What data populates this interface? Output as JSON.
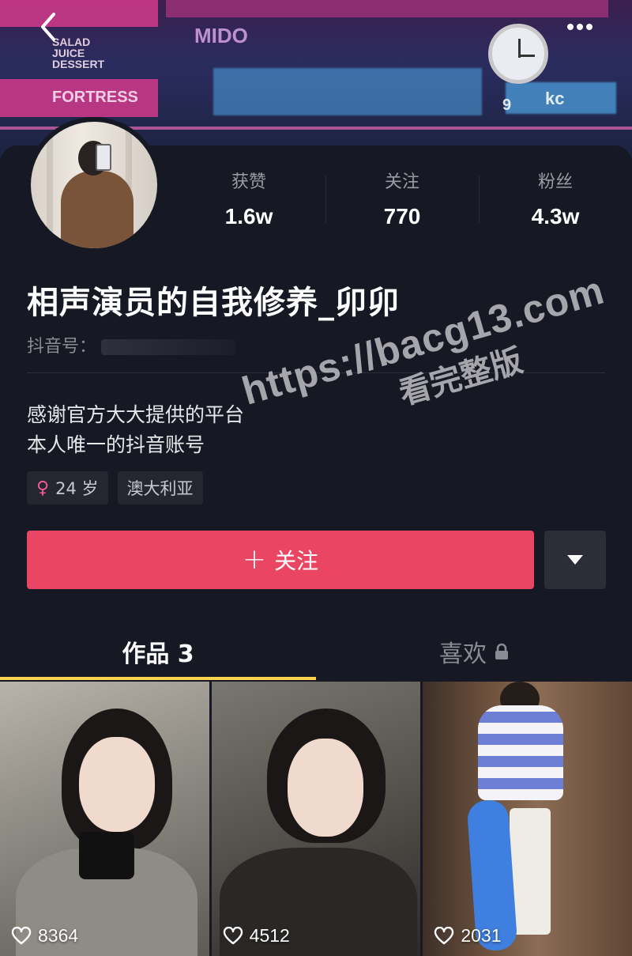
{
  "cover": {
    "signs": [
      "SALAD",
      "JUICE",
      "DESSERT",
      "FORTRESS",
      "MIDO",
      "9",
      "kc"
    ]
  },
  "nav": {
    "back_icon": "chevron-left-icon",
    "more_icon": "more-dots-icon"
  },
  "profile": {
    "stats": [
      {
        "label": "获赞",
        "value": "1.6w"
      },
      {
        "label": "关注",
        "value": "770"
      },
      {
        "label": "粉丝",
        "value": "4.3w"
      }
    ],
    "nickname": "相声演员的自我修养_卯卯",
    "id_label": "抖音号：",
    "bio_lines": [
      "感谢官方大大提供的平台",
      "本人唯一的抖音账号"
    ],
    "tags": [
      {
        "icon": "female-icon",
        "icon_glyph": "♀",
        "label": "24 岁"
      },
      {
        "label": "澳大利亚"
      }
    ]
  },
  "actions": {
    "follow_label": "关注",
    "follow_plus": "+",
    "dropdown_icon": "caret-down-icon"
  },
  "tabs": [
    {
      "label": "作品 3",
      "active": true
    },
    {
      "label": "喜欢",
      "active": false,
      "icon": "lock-icon"
    }
  ],
  "works": [
    {
      "likes": "8364"
    },
    {
      "likes": "4512"
    },
    {
      "likes": "2031"
    }
  ],
  "watermark": {
    "line1": "https://bacg13.com",
    "line2": "看完整版"
  },
  "colors": {
    "background": "#161823",
    "accent": "#ea4562",
    "tab_indicator": "#fbd34e",
    "tag_bg": "#25262f"
  }
}
